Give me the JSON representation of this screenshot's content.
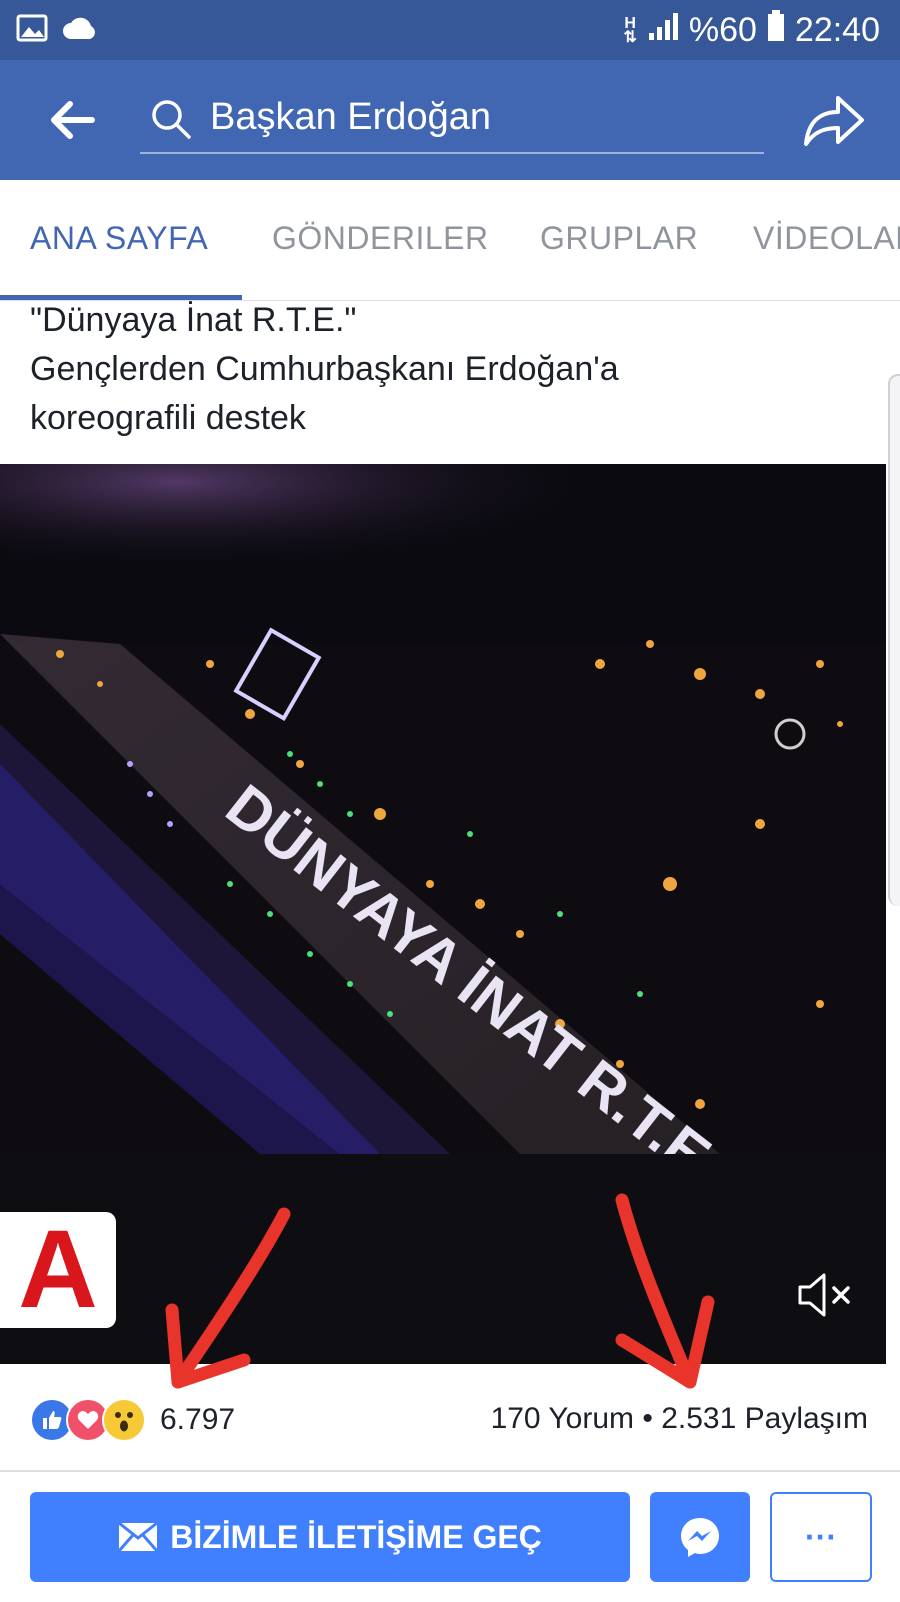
{
  "status_bar": {
    "network": "H",
    "battery_percent": "%60",
    "time": "22:40",
    "icons": [
      "image-icon",
      "cloud-icon",
      "data-arrows-icon",
      "signal-icon",
      "battery-icon"
    ]
  },
  "header": {
    "search_value": "Başkan Erdoğan",
    "icons": [
      "back-arrow-icon",
      "search-icon",
      "share-icon"
    ],
    "colors": {
      "statusbar": "#365899",
      "bar": "#4267b2"
    }
  },
  "tabs": [
    {
      "label": "ANA SAYFA",
      "active": true
    },
    {
      "label": "GÖNDERILER",
      "active": false
    },
    {
      "label": "GRUPLAR",
      "active": false
    },
    {
      "label": "VİDEOLAR",
      "active": false
    }
  ],
  "post": {
    "text_lines": [
      "\"Dünyaya İnat R.T.E.\"",
      "Gençlerden Cumhurbaşkanı Erdoğan'a",
      "koreografili destek"
    ],
    "video": {
      "overlay_text": "DÜNYAYA İNAT R.T.E",
      "channel_logo": "A",
      "muted": true
    }
  },
  "engagement": {
    "reaction_count": "6.797",
    "reaction_icons": [
      "like-reaction-icon",
      "love-reaction-icon",
      "wow-reaction-icon"
    ],
    "comments": "170 Yorum",
    "separator": "•",
    "shares": "2.531 Paylaşım"
  },
  "actions": {
    "contact_label": "BİZİMLE İLETİŞİME GEÇ",
    "more_label": "···",
    "accent": "#4080ff"
  },
  "annotations": {
    "arrow_color": "#e8342a"
  }
}
